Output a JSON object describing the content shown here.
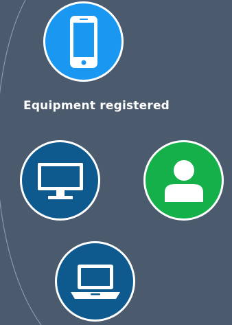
{
  "caption": "Equipment registered",
  "colors": {
    "background": "#4b5a6d",
    "phone": "#1a97f0",
    "monitor": "#0e5a8e",
    "user": "#15b04a",
    "laptop": "#0e5a8e",
    "outline": "#ffffff"
  },
  "icons": {
    "phone": "smartphone-icon",
    "monitor": "monitor-icon",
    "user": "user-icon",
    "laptop": "laptop-icon"
  }
}
